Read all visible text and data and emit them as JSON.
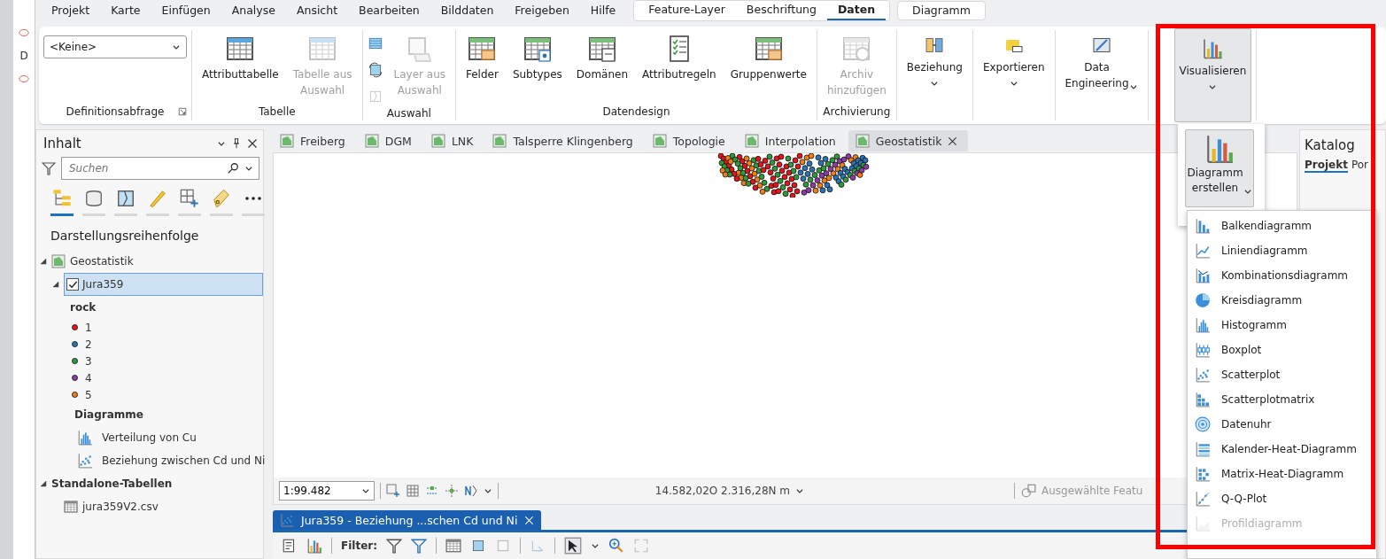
{
  "left_strip": {
    "label": "D"
  },
  "menu_bar": {
    "tabs": [
      {
        "label": "Projekt",
        "selected": false
      },
      {
        "label": "Karte",
        "selected": false
      },
      {
        "label": "Einfügen",
        "selected": false
      },
      {
        "label": "Analyse",
        "selected": false
      },
      {
        "label": "Ansicht",
        "selected": false
      },
      {
        "label": "Bearbeiten",
        "selected": false
      },
      {
        "label": "Bilddaten",
        "selected": false
      },
      {
        "label": "Freigeben",
        "selected": false
      },
      {
        "label": "Hilfe",
        "selected": false
      }
    ],
    "context_groups": [
      {
        "tabs": [
          {
            "label": "Feature-Layer",
            "selected": false
          },
          {
            "label": "Beschriftung",
            "selected": false
          },
          {
            "label": "Daten",
            "selected": true
          }
        ]
      },
      {
        "tabs": [
          {
            "label": "Diagramm",
            "selected": false
          }
        ]
      }
    ]
  },
  "ribbon": [
    {
      "title": "Definitionsabfrage",
      "launcher": true,
      "items": [
        {
          "kind": "dropdown",
          "value": "<Keine>"
        }
      ]
    },
    {
      "title": "Tabelle",
      "items": [
        {
          "kind": "attribute-table",
          "label": "Attributtabelle",
          "disabled": false
        },
        {
          "kind": "table-from-selection",
          "label": "Tabelle aus\nAuswahl",
          "disabled": true
        }
      ]
    },
    {
      "title": "Auswahl",
      "items": [
        {
          "kind": "small-stack",
          "buttons": [
            {
              "kind": "select-rows",
              "disabled": false
            },
            {
              "kind": "switch-selection",
              "disabled": false
            },
            {
              "kind": "clear-selection",
              "disabled": true
            }
          ]
        },
        {
          "kind": "layer-from-selection",
          "label": "Layer aus\nAuswahl",
          "disabled": true
        }
      ]
    },
    {
      "title": "Datendesign",
      "items": [
        {
          "kind": "fields",
          "label": "Felder",
          "disabled": false
        },
        {
          "kind": "subtypes",
          "label": "Subtypes",
          "disabled": false
        },
        {
          "kind": "domains",
          "label": "Domänen",
          "disabled": false
        },
        {
          "kind": "attribute-rules",
          "label": "Attributregeln",
          "disabled": false
        },
        {
          "kind": "group-values",
          "label": "Gruppenwerte",
          "disabled": false
        }
      ]
    },
    {
      "title": "Archivierung",
      "items": [
        {
          "kind": "archive",
          "label": "Archiv\nhinzufügen",
          "disabled": true
        }
      ]
    },
    {
      "items": [
        {
          "kind": "relationship",
          "label": "Beziehung",
          "disabled": false,
          "menu": true
        }
      ]
    },
    {
      "items": [
        {
          "kind": "export",
          "label": "Exportieren",
          "disabled": false,
          "menu": true
        }
      ]
    },
    {
      "items": [
        {
          "kind": "data-engineering",
          "label": "Data\nEngineering",
          "disabled": false,
          "menu": true,
          "inline_caret": true
        }
      ]
    },
    {
      "items": [
        {
          "kind": "visualize",
          "label": "Visualisieren",
          "disabled": false,
          "menu": true,
          "pressed": true
        }
      ]
    }
  ],
  "contents": {
    "title": "Inhalt",
    "search": {
      "placeholder": "Suchen"
    },
    "tools": [
      {
        "kind": "drawing-order",
        "selected": true
      },
      {
        "kind": "data-source",
        "selected": false
      },
      {
        "kind": "selection",
        "selected": false
      },
      {
        "kind": "editing",
        "selected": false
      },
      {
        "kind": "snapping",
        "selected": false
      },
      {
        "kind": "labeling",
        "selected": false
      },
      {
        "kind": "more",
        "selected": false
      }
    ],
    "heading": "Darstellungsreihenfolge",
    "tree": [
      {
        "kind": "map",
        "label": "Geostatistik",
        "expanded": true,
        "children": [
          {
            "kind": "layer",
            "label": "Jura359",
            "expanded": true,
            "checked": true,
            "selected": true,
            "legend": {
              "field": "rock",
              "classes": [
                {
                  "label": "1",
                  "color": "#e5131a"
                },
                {
                  "label": "2",
                  "color": "#2a73b8"
                },
                {
                  "label": "3",
                  "color": "#2e9a3c"
                },
                {
                  "label": "4",
                  "color": "#8e3ba6"
                },
                {
                  "label": "5",
                  "color": "#f07e12"
                }
              ]
            },
            "charts_heading": "Diagramme",
            "charts": [
              {
                "kind": "histogram",
                "label": "Verteilung von Cu"
              },
              {
                "kind": "scatter",
                "label": "Beziehung zwischen Cd und Ni"
              }
            ]
          }
        ]
      },
      {
        "kind": "group",
        "label": "Standalone-Tabellen",
        "expanded": true,
        "children": [
          {
            "kind": "table",
            "label": "jura359V2.csv"
          }
        ]
      }
    ]
  },
  "map_tabs": [
    {
      "label": "Freiberg",
      "selected": false
    },
    {
      "label": "DGM",
      "selected": false
    },
    {
      "label": "LNK",
      "selected": false
    },
    {
      "label": "Talsperre Klingenberg",
      "selected": false
    },
    {
      "label": "Topologie",
      "selected": false
    },
    {
      "label": "Interpolation",
      "selected": false
    },
    {
      "label": "Geostatistik",
      "selected": true
    }
  ],
  "map_status": {
    "scale": "1:99.482",
    "coordinates": "14.582,02O 2.316,28N m",
    "selected_features": "Ausgewählte Featu"
  },
  "chart_view": {
    "tab": "Jura359 - Beziehung ...schen Cd und Ni",
    "filter_label": "Filter:"
  },
  "catalog": {
    "title": "Katalog",
    "tabs": [
      {
        "label": "Projekt",
        "selected": true
      },
      {
        "label": "Por",
        "selected": false
      }
    ]
  },
  "chart_menu": {
    "button": "Diagramm\nerstellen",
    "items": [
      {
        "kind": "bar",
        "label": "Balkendiagramm",
        "disabled": false
      },
      {
        "kind": "line",
        "label": "Liniendiagramm",
        "disabled": false
      },
      {
        "kind": "combo",
        "label": "Kombinationsdiagramm",
        "disabled": false
      },
      {
        "kind": "pie",
        "label": "Kreisdiagramm",
        "disabled": false
      },
      {
        "kind": "histogram",
        "label": "Histogramm",
        "disabled": false
      },
      {
        "kind": "boxplot",
        "label": "Boxplot",
        "disabled": false
      },
      {
        "kind": "scatter",
        "label": "Scatterplot",
        "disabled": false
      },
      {
        "kind": "matrix",
        "label": "Scatterplotmatrix",
        "disabled": false
      },
      {
        "kind": "clock",
        "label": "Datenuhr",
        "disabled": false
      },
      {
        "kind": "calendar",
        "label": "Kalender-Heat-Diagramm",
        "disabled": false
      },
      {
        "kind": "heat",
        "label": "Matrix-Heat-Diagramm",
        "disabled": false
      },
      {
        "kind": "qq",
        "label": "Q-Q-Plot",
        "disabled": false
      },
      {
        "kind": "profile",
        "label": "Profildiagramm",
        "disabled": true
      }
    ]
  }
}
